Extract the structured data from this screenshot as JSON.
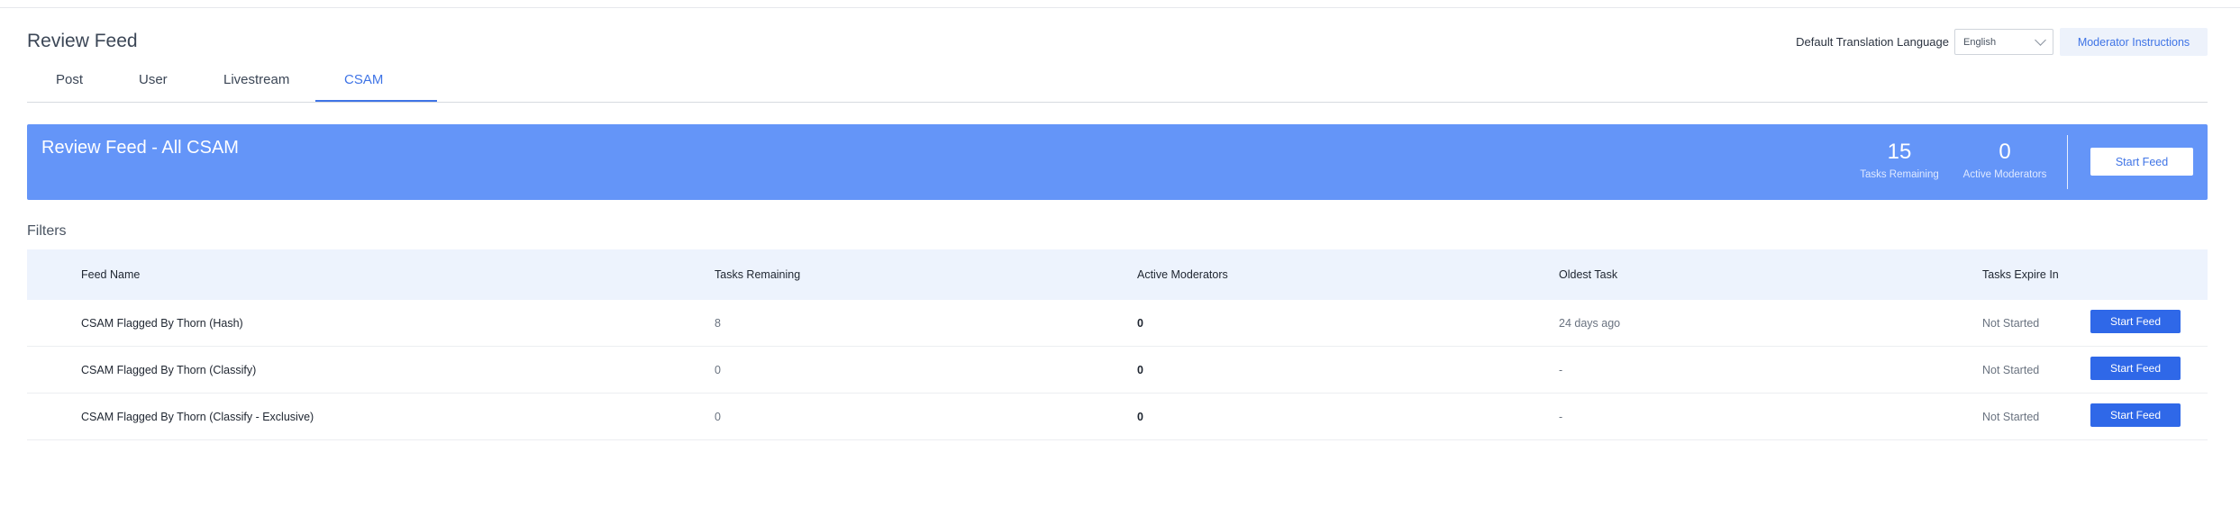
{
  "page": {
    "title": "Review Feed"
  },
  "tabs": [
    {
      "label": "Post"
    },
    {
      "label": "User"
    },
    {
      "label": "Livestream"
    },
    {
      "label": "CSAM",
      "active": true
    }
  ],
  "header": {
    "language_label": "Default Translation Language",
    "language_value": "English",
    "instructions_label": "Moderator Instructions"
  },
  "banner": {
    "title": "Review Feed - All CSAM",
    "tasks_remaining": {
      "value": "15",
      "label": "Tasks Remaining"
    },
    "active_moderators": {
      "value": "0",
      "label": "Active Moderators"
    },
    "start_label": "Start Feed",
    "background_color": "#6495f8"
  },
  "filters_label": "Filters",
  "table": {
    "columns": [
      "Feed Name",
      "Tasks Remaining",
      "Active Moderators",
      "Oldest Task",
      "Tasks Expire In"
    ],
    "rows": [
      {
        "feed_name": "CSAM Flagged By Thorn (Hash)",
        "tasks_remaining": "8",
        "active_moderators": "0",
        "oldest_task": "24 days ago",
        "expire": "Not Started",
        "action": "Start Feed"
      },
      {
        "feed_name": "CSAM Flagged By Thorn (Classify)",
        "tasks_remaining": "0",
        "active_moderators": "0",
        "oldest_task": "-",
        "expire": "Not Started",
        "action": "Start Feed"
      },
      {
        "feed_name": "CSAM Flagged By Thorn (Classify - Exclusive)",
        "tasks_remaining": "0",
        "active_moderators": "0",
        "oldest_task": "-",
        "expire": "Not Started",
        "action": "Start Feed"
      }
    ]
  },
  "colors": {
    "accent": "#3f74e6",
    "button": "#2f68e8",
    "table_header_bg": "#edf3fd"
  }
}
